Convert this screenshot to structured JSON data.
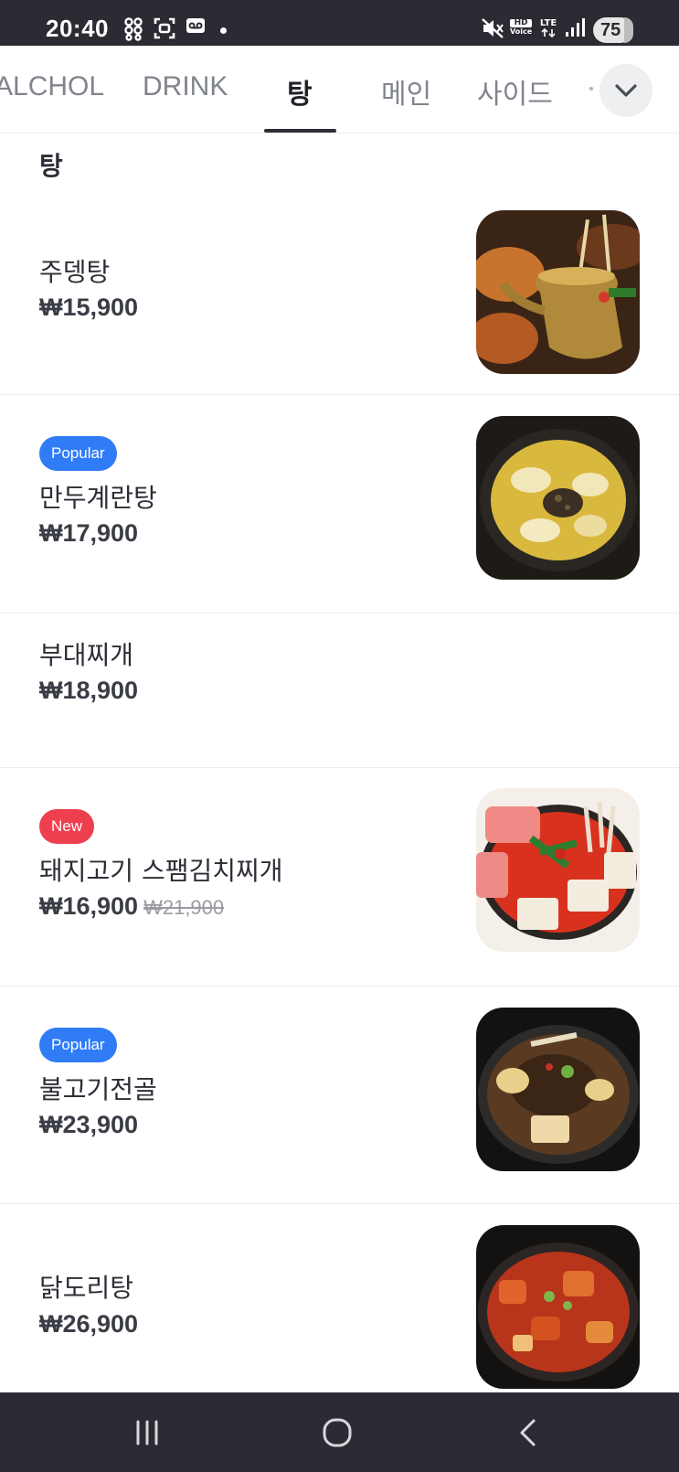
{
  "status_bar": {
    "time": "20:40",
    "battery": "75",
    "hd_label": "HD",
    "voice_label": "Voice",
    "lte_label": "LTE",
    "icons": [
      "pinwheel-icon",
      "screenshot-icon",
      "voicemail-icon",
      "notification-dot-icon",
      "mute-icon",
      "signal-icon",
      "battery-icon"
    ]
  },
  "tabs": {
    "items": [
      {
        "label": "ALCHOL",
        "active": false
      },
      {
        "label": "DRINK",
        "active": false
      },
      {
        "label": "탕",
        "active": true
      },
      {
        "label": "메인",
        "active": false
      },
      {
        "label": "사이드",
        "active": false
      }
    ],
    "expand_icon": "chevron-down-icon"
  },
  "section": {
    "title": "탕",
    "items": [
      {
        "name": "주뎅탕",
        "price": "₩15,900",
        "badge": null,
        "photo": "kettle-soup"
      },
      {
        "name": "만두계란탕",
        "price": "₩17,900",
        "badge": "Popular",
        "photo": "egg-soup"
      },
      {
        "name": "부대찌개",
        "price": "₩18,900",
        "badge": null,
        "photo": null
      },
      {
        "name": "돼지고기 스팸김치찌개",
        "price": "₩16,900",
        "original_price": "₩21,900",
        "badge": "New",
        "photo": "spam-kimchi-stew"
      },
      {
        "name": "불고기전골",
        "price": "₩23,900",
        "badge": "Popular",
        "photo": "bulgogi-hotpot"
      },
      {
        "name": "닭도리탕",
        "price": "₩26,900",
        "badge": null,
        "photo": "braised-chicken"
      }
    ]
  },
  "colors": {
    "badge_popular": "#2f7cf6",
    "badge_new": "#ee3f4f",
    "system_bar": "#2b2b33"
  },
  "nav_bar": {
    "icons": [
      "recent-apps-icon",
      "home-icon",
      "back-icon"
    ]
  }
}
